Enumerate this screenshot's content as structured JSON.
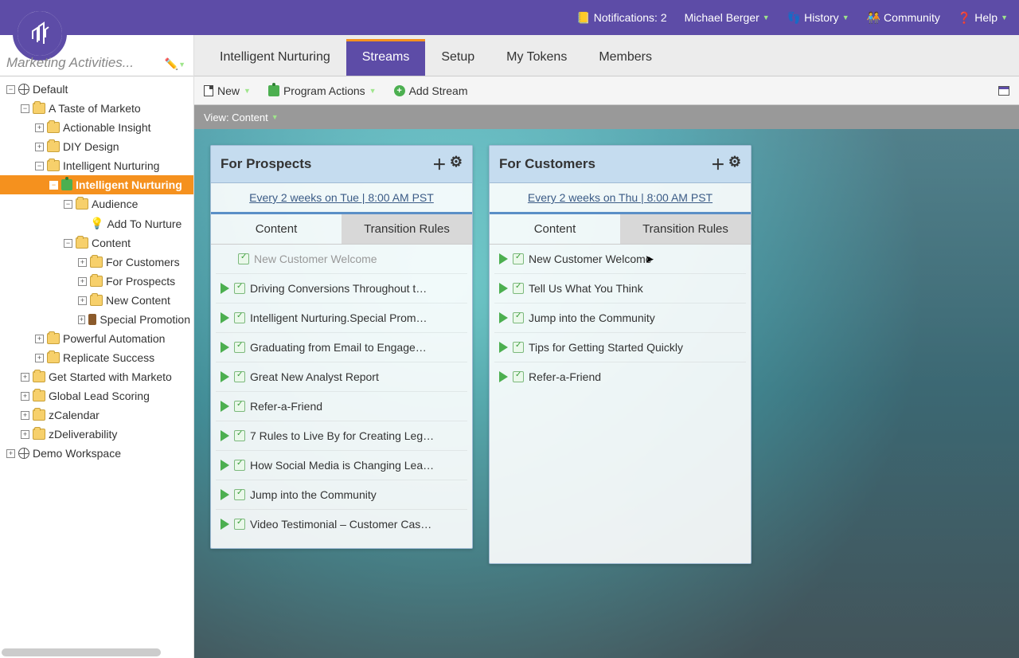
{
  "header": {
    "notifications": "Notifications: 2",
    "user": "Michael Berger",
    "history": "History",
    "community": "Community",
    "help": "Help"
  },
  "sidebar": {
    "title": "Marketing Activities...",
    "tree": {
      "default": "Default",
      "taste": "A Taste of Marketo",
      "actionable": "Actionable Insight",
      "diy": "DIY Design",
      "intNurtFolder": "Intelligent Nurturing",
      "intNurtProgram": "Intelligent Nurturing",
      "audience": "Audience",
      "addToNurture": "Add To Nurture",
      "content": "Content",
      "forCustomers": "For Customers",
      "forProspects": "For Prospects",
      "newContent": "New Content",
      "specialPromo": "Special Promotion",
      "powerful": "Powerful Automation",
      "replicate": "Replicate Success",
      "getStarted": "Get Started with Marketo",
      "globalLead": "Global Lead Scoring",
      "zcal": "zCalendar",
      "zdev": "zDeliverability",
      "demo": "Demo Workspace"
    }
  },
  "mainTabs": {
    "t0": "Intelligent Nurturing",
    "t1": "Streams",
    "t2": "Setup",
    "t3": "My Tokens",
    "t4": "Members"
  },
  "actions": {
    "new": "New",
    "programActions": "Program Actions",
    "addStream": "Add Stream"
  },
  "viewBar": "View: Content",
  "streams": [
    {
      "title": "For Prospects",
      "schedule": "Every 2 weeks on Tue | 8:00 AM PST",
      "tabs": {
        "content": "Content",
        "rules": "Transition Rules"
      },
      "items": [
        {
          "label": "New Customer Welcome",
          "disabled": true
        },
        {
          "label": "Driving Conversions Throughout t…"
        },
        {
          "label": "Intelligent Nurturing.Special Prom…"
        },
        {
          "label": "Graduating from Email to Engage…"
        },
        {
          "label": "Great New Analyst Report"
        },
        {
          "label": "Refer-a-Friend"
        },
        {
          "label": "7 Rules to Live By for Creating Leg…"
        },
        {
          "label": "How Social Media is Changing Lea…"
        },
        {
          "label": "Jump into the Community"
        },
        {
          "label": "Video Testimonial – Customer Cas…"
        }
      ]
    },
    {
      "title": "For Customers",
      "schedule": "Every 2 weeks on Thu | 8:00 AM PST",
      "tabs": {
        "content": "Content",
        "rules": "Transition Rules"
      },
      "items": [
        {
          "label": "New Customer Welcome"
        },
        {
          "label": "Tell Us What You Think"
        },
        {
          "label": "Jump into the Community"
        },
        {
          "label": "Tips for Getting Started Quickly"
        },
        {
          "label": "Refer-a-Friend"
        }
      ]
    }
  ]
}
